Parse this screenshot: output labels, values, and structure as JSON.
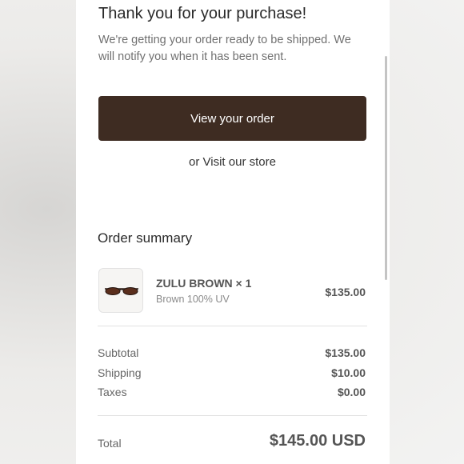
{
  "header": {
    "title": "Thank you for your purchase!",
    "subtitle": "We're getting your order ready to be shipped. We will notify you when it has been sent."
  },
  "actions": {
    "view_order_label": "View your order",
    "visit_store_label": "or Visit our store"
  },
  "summary": {
    "title": "Order summary",
    "item": {
      "name": "ZULU BROWN × 1",
      "variant": "Brown 100% UV",
      "price": "$135.00",
      "thumbnail_icon": "sunglasses-icon"
    },
    "rows": [
      {
        "label": "Subtotal",
        "value": "$135.00"
      },
      {
        "label": "Shipping",
        "value": "$10.00"
      },
      {
        "label": "Taxes",
        "value": "$0.00"
      }
    ],
    "total": {
      "label": "Total",
      "value": "$145.00 USD"
    }
  },
  "colors": {
    "primary_button": "#3e2c22",
    "card_background": "#ffffff",
    "page_background": "#ecebe9"
  }
}
